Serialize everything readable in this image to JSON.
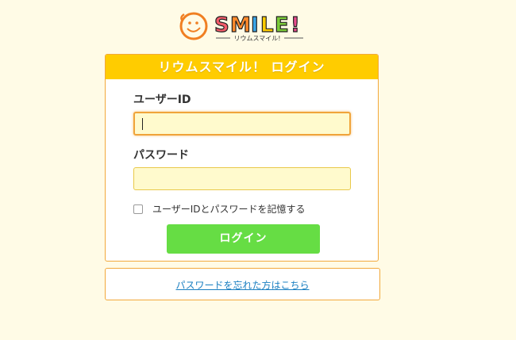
{
  "logo": {
    "wordmark": "SMILE!",
    "tagline": "リウムスマイル!",
    "icon": "smiley-sun-icon"
  },
  "login_panel": {
    "title": "リウムスマイル！ ログイン",
    "user_id_label": "ユーザーID",
    "user_id_value": "",
    "password_label": "パスワード",
    "password_value": "",
    "remember_label": "ユーザーIDとパスワードを記憶する",
    "remember_checked": false,
    "login_button": "ログイン"
  },
  "forgot_link": "パスワードを忘れた方はこちら",
  "colors": {
    "background": "#FFFBE6",
    "header": "#FFCC00",
    "border": "#F2A93B",
    "input_bg": "#FFFACD",
    "button": "#66DD44",
    "link": "#1A7FC1"
  }
}
